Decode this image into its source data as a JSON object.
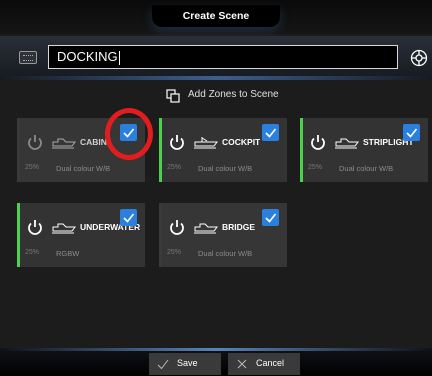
{
  "header": {
    "title": "Create Scene"
  },
  "scene_name": {
    "value": "DOCKING"
  },
  "add_zones": {
    "label": "Add Zones to Scene"
  },
  "zones": [
    {
      "name": "CABIN",
      "brightness": "25%",
      "type": "Dual colour W/B",
      "checked": true,
      "on": false
    },
    {
      "name": "COCKPIT",
      "brightness": "25%",
      "type": "Dual colour W/B",
      "checked": true,
      "on": true
    },
    {
      "name": "STRIPLIGHT",
      "brightness": "25%",
      "type": "Dual colour W/B",
      "checked": true,
      "on": true
    },
    {
      "name": "UNDERWATER",
      "brightness": "25%",
      "type": "RGBW",
      "checked": true,
      "on": true
    },
    {
      "name": "BRIDGE",
      "brightness": "25%",
      "type": "Dual colour W/B",
      "checked": true,
      "on": false
    }
  ],
  "footer": {
    "save_label": "Save",
    "cancel_label": "Cancel"
  },
  "colors": {
    "accent_green": "#4bd14b",
    "check_blue": "#2b7fde",
    "highlight_red": "#e31d1d"
  }
}
